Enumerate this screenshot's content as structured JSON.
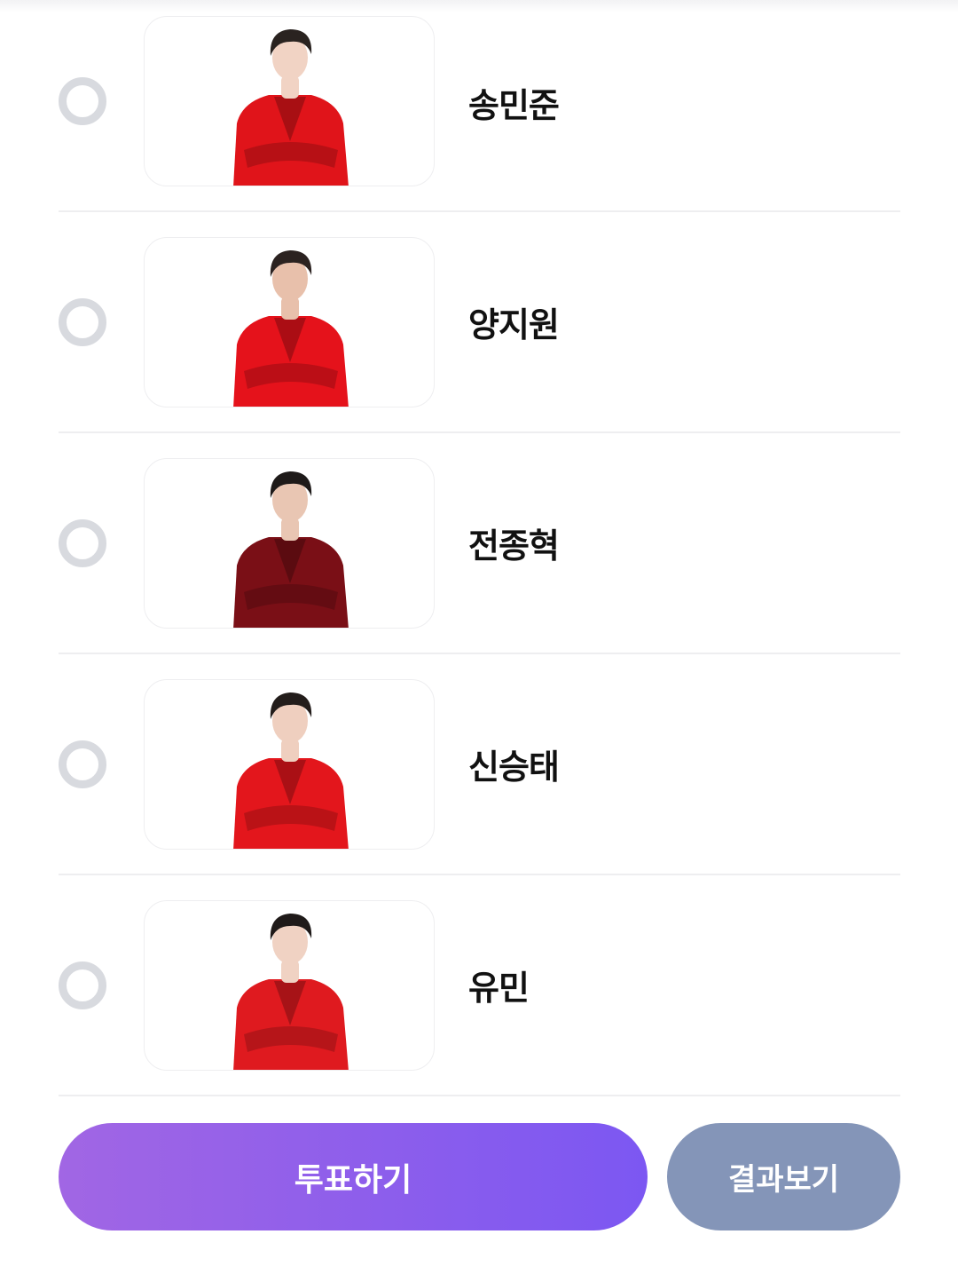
{
  "candidates": [
    {
      "name": "송민준",
      "outfit_color": "#e0141a",
      "hair_color": "#2a2320",
      "skin_color": "#f1d3c4",
      "photo": "person-photo"
    },
    {
      "name": "양지원",
      "outfit_color": "#e5121b",
      "hair_color": "#2b2220",
      "skin_color": "#e8c0ab",
      "photo": "person-photo"
    },
    {
      "name": "전종혁",
      "outfit_color": "#7a0f16",
      "hair_color": "#1e1a19",
      "skin_color": "#e9c6b3",
      "photo": "person-photo"
    },
    {
      "name": "신승태",
      "outfit_color": "#e3161c",
      "hair_color": "#231d1b",
      "skin_color": "#efcfbf",
      "photo": "person-photo"
    },
    {
      "name": "유민",
      "outfit_color": "#df1a1f",
      "hair_color": "#1f1a19",
      "skin_color": "#f0d2c3",
      "photo": "person-photo"
    }
  ],
  "actions": {
    "vote_label": "투표하기",
    "result_label": "결과보기"
  },
  "colors": {
    "vote_gradient_start": "#a166e4",
    "vote_gradient_end": "#7c57f2",
    "result_button": "#8495b8",
    "radio_border": "#d8dadf"
  }
}
